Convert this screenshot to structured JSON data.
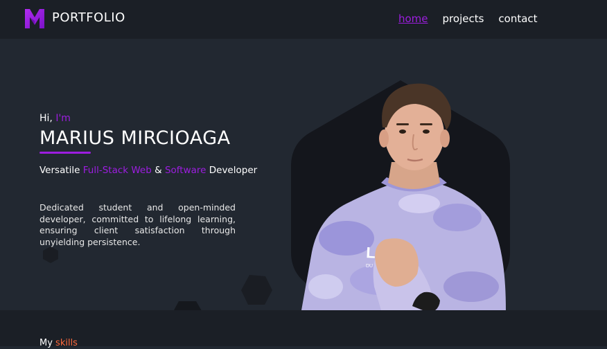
{
  "nav": {
    "logo_text": "PORTFOLIO",
    "logo_icon": "m-logo-icon",
    "links": [
      {
        "label": "home",
        "active": true
      },
      {
        "label": "projects",
        "active": false
      },
      {
        "label": "contact",
        "active": false
      }
    ]
  },
  "hero": {
    "greeting_prefix": "Hi, ",
    "greeting_accent": "I'm",
    "name": "MARIUS MIRCIOAGA",
    "tagline": {
      "prefix": "Versatile ",
      "accent1": "Full-Stack Web",
      "middle": " & ",
      "accent2": "Software",
      "suffix": " Developer"
    },
    "description": "Dedicated student and open-minded developer, committed to lifelong learning, ensuring client satisfaction through unyielding persistence.",
    "portrait_icon": "portrait-photo"
  },
  "skills": {
    "title_prefix": "My ",
    "title_accent": "skills"
  },
  "colors": {
    "background": "#222831",
    "navbar": "#1b1f26",
    "accent": "#9d1de0",
    "skills_accent": "#ff6a3d",
    "hexagon": "#14161c"
  }
}
